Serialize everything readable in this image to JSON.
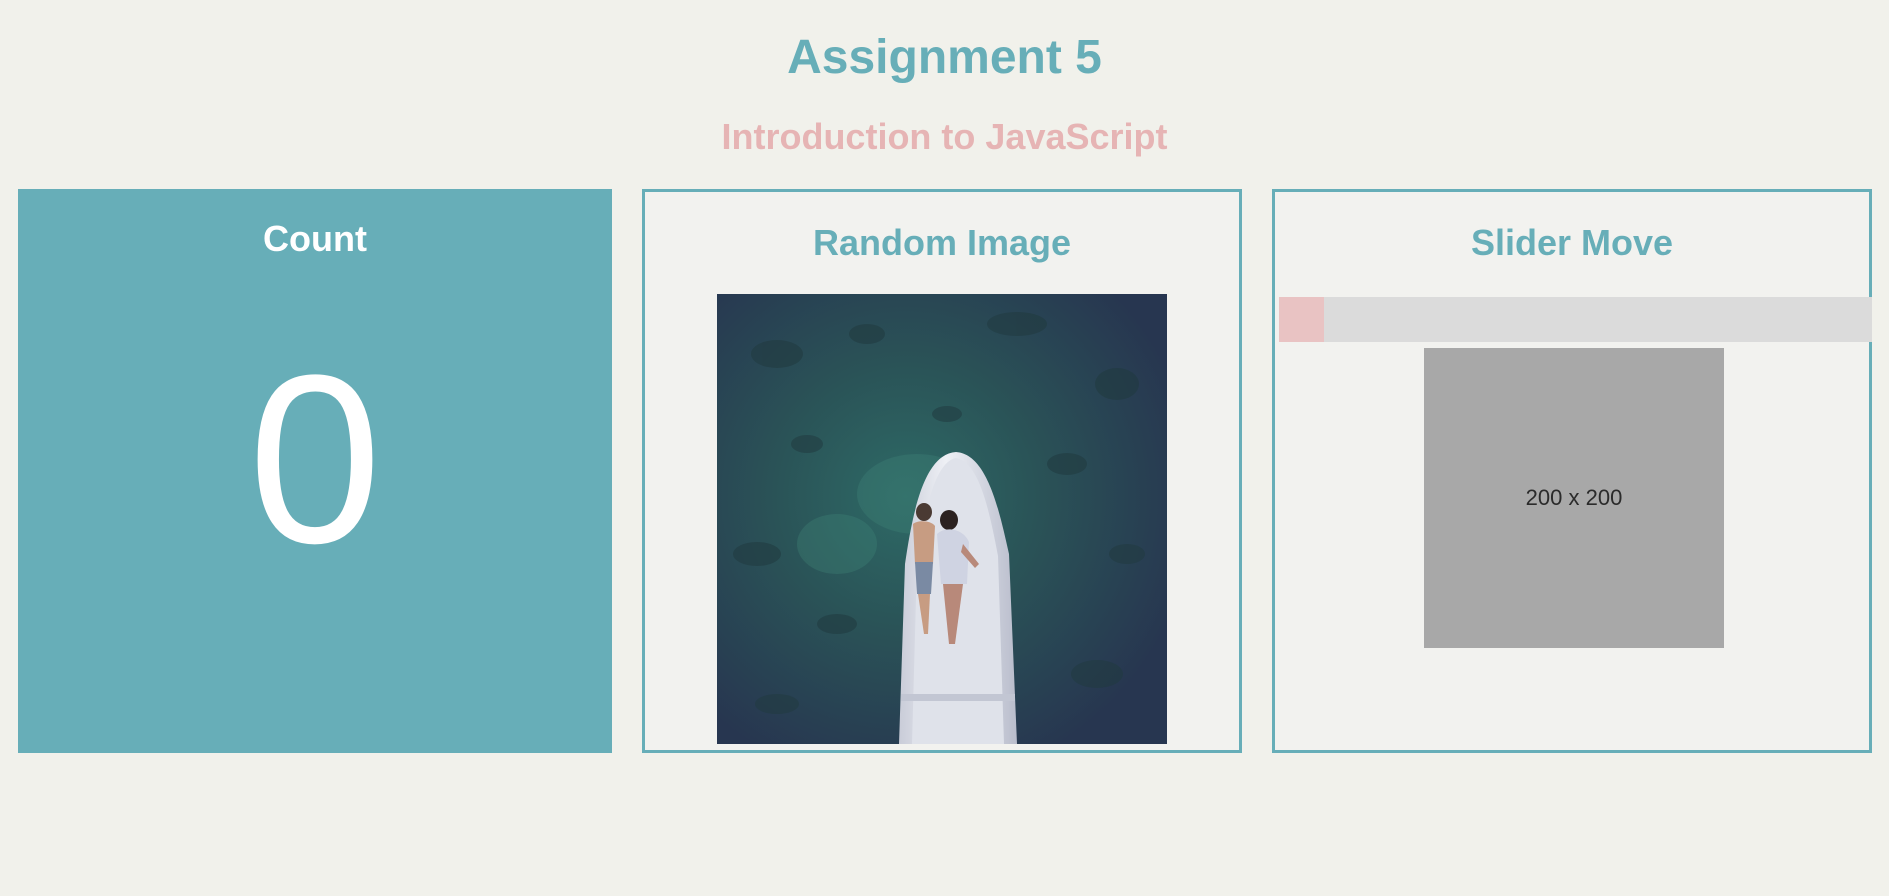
{
  "header": {
    "title": "Assignment 5",
    "subtitle": "Introduction to JavaScript"
  },
  "count_card": {
    "title": "Count",
    "value": "0"
  },
  "image_card": {
    "title": "Random Image",
    "image_alt": "Aerial photo of two people lying on a white boat over dark water"
  },
  "slider_card": {
    "title": "Slider Move",
    "placeholder_label": "200 x 200"
  },
  "colors": {
    "page_background": "#f1f1eb",
    "accent_teal": "#67aeb8",
    "accent_pink": "#e6b4b4",
    "slider_track": "#dbdbdb",
    "slider_handle": "#e9c3c3",
    "placeholder_gray": "#a8a8a8"
  },
  "icons": {
    "slider_handle": "square-handle"
  }
}
